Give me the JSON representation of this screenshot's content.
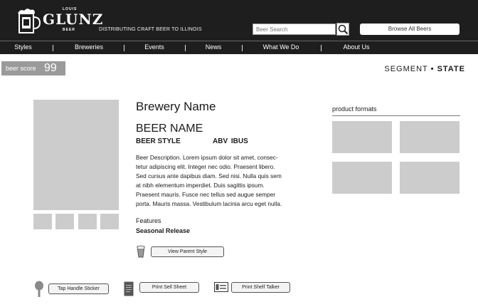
{
  "header": {
    "logo_top": "LOUIS",
    "logo_main": "GLUNZ",
    "logo_bottom": "BEER",
    "tagline": "DISTRIBUTING CRAFT BEER TO ILLINOIS",
    "search_placeholder": "Beer Search",
    "browse_label": "Browse All Beers"
  },
  "nav": {
    "items": [
      "Styles",
      "Breweries",
      "Events",
      "News",
      "What We Do",
      "About Us"
    ]
  },
  "score": {
    "label": "beer score",
    "value": "99"
  },
  "segment": {
    "segment": "SEGMENT",
    "separator": "•",
    "state": "STATE"
  },
  "beer": {
    "brewery_name": "Brewery Name",
    "beer_name": "BEER NAME",
    "beer_style": "BEER STYLE",
    "abv_ibus": "ABV IBUS",
    "description": [
      "Beer Description. Lorem ipsum dolor sit amet, consec-",
      "tetur adipiscing elit. Integer nec odio. Praesent libero.",
      "Sed cursus ante dapibus diam. Sed nisi. Nulla quis sem",
      "at nibh elementum imperdiet. Duis sagittis ipsum.",
      "Praesent mauris. Fusce nec tellus sed augue semper",
      "porta. Mauris massa. Vestibulum lacinia arcu eget nulla."
    ],
    "features_label": "Features",
    "features_value": "Seasonal Release",
    "view_parent_style": "View Parent Style"
  },
  "actions": {
    "tap_handle_sticker": "Tap Handle Sticker",
    "print_sell_sheet": "Print Sell Sheet",
    "print_shelf_talker": "Print Shelf Talker"
  },
  "product_formats": {
    "label": "product formats"
  },
  "icons": {
    "search": "search-icon",
    "glass": "beer-glass-icon",
    "tap_handle": "tap-handle-icon",
    "sell_sheet": "document-icon",
    "shelf_talker": "shelf-talker-icon"
  },
  "colors": {
    "header_bg": "#1e1e1e",
    "placeholder_gray": "#cccccc",
    "score_bg": "#9a9a9a"
  }
}
